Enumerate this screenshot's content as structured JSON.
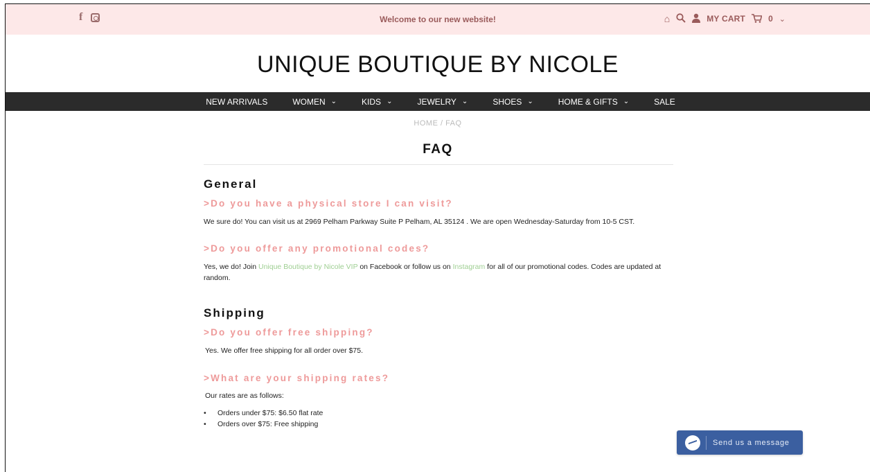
{
  "topbar": {
    "welcome": "Welcome to our new website!",
    "cart_label": "MY CART",
    "cart_count": "0",
    "icons": [
      "facebook-icon",
      "instagram-icon",
      "home-icon",
      "search-icon",
      "user-icon",
      "cart-icon",
      "chevron-down-icon"
    ]
  },
  "logo": "UNIQUE BOUTIQUE BY NICOLE",
  "nav": [
    {
      "label": "NEW ARRIVALS",
      "caret": ""
    },
    {
      "label": "WOMEN",
      "caret": "⌄"
    },
    {
      "label": "KIDS",
      "caret": "⌄"
    },
    {
      "label": "JEWELRY",
      "caret": "⌄"
    },
    {
      "label": "SHOES",
      "caret": "⌄"
    },
    {
      "label": "HOME & GIFTS",
      "caret": "⌄"
    },
    {
      "label": "SALE",
      "caret": ""
    }
  ],
  "breadcrumb": "HOME / FAQ",
  "title": "FAQ",
  "general": {
    "heading": "General",
    "q1": ">Do you have a physical store I can visit?",
    "a1": "We sure do! You can visit us at 2969 Pelham Parkway Suite P Pelham, AL 35124 . We are open Wednesday-Saturday from 10-5 CST.",
    "q2": ">Do you offer any promotional codes?",
    "a2_pre": "Yes, we do! Join ",
    "a2_link1": "Unique Boutique by Nicole VIP",
    "a2_mid": " on Facebook or follow us on ",
    "a2_link2": "Instagram",
    "a2_post": " for all of our promotional codes. Codes are updated at random."
  },
  "shipping": {
    "heading": "Shipping",
    "q1": ">Do you offer free shipping?",
    "a1": "Yes. We offer free shipping for all order over $75.",
    "q2": ">What are your shipping rates?",
    "a2": "Our rates are as follows:",
    "bullets": [
      "Orders under $75: $6.50 flat rate",
      "Orders over $75: Free shipping"
    ]
  },
  "messenger": {
    "label": "Send us a message"
  },
  "colors": {
    "accent_pink": "#ee9a9a",
    "link_green": "#9fcf93",
    "nav_bg": "#2b2b2b",
    "topbar_bg": "#fde8e8",
    "messenger_blue": "#3b5fa0"
  }
}
